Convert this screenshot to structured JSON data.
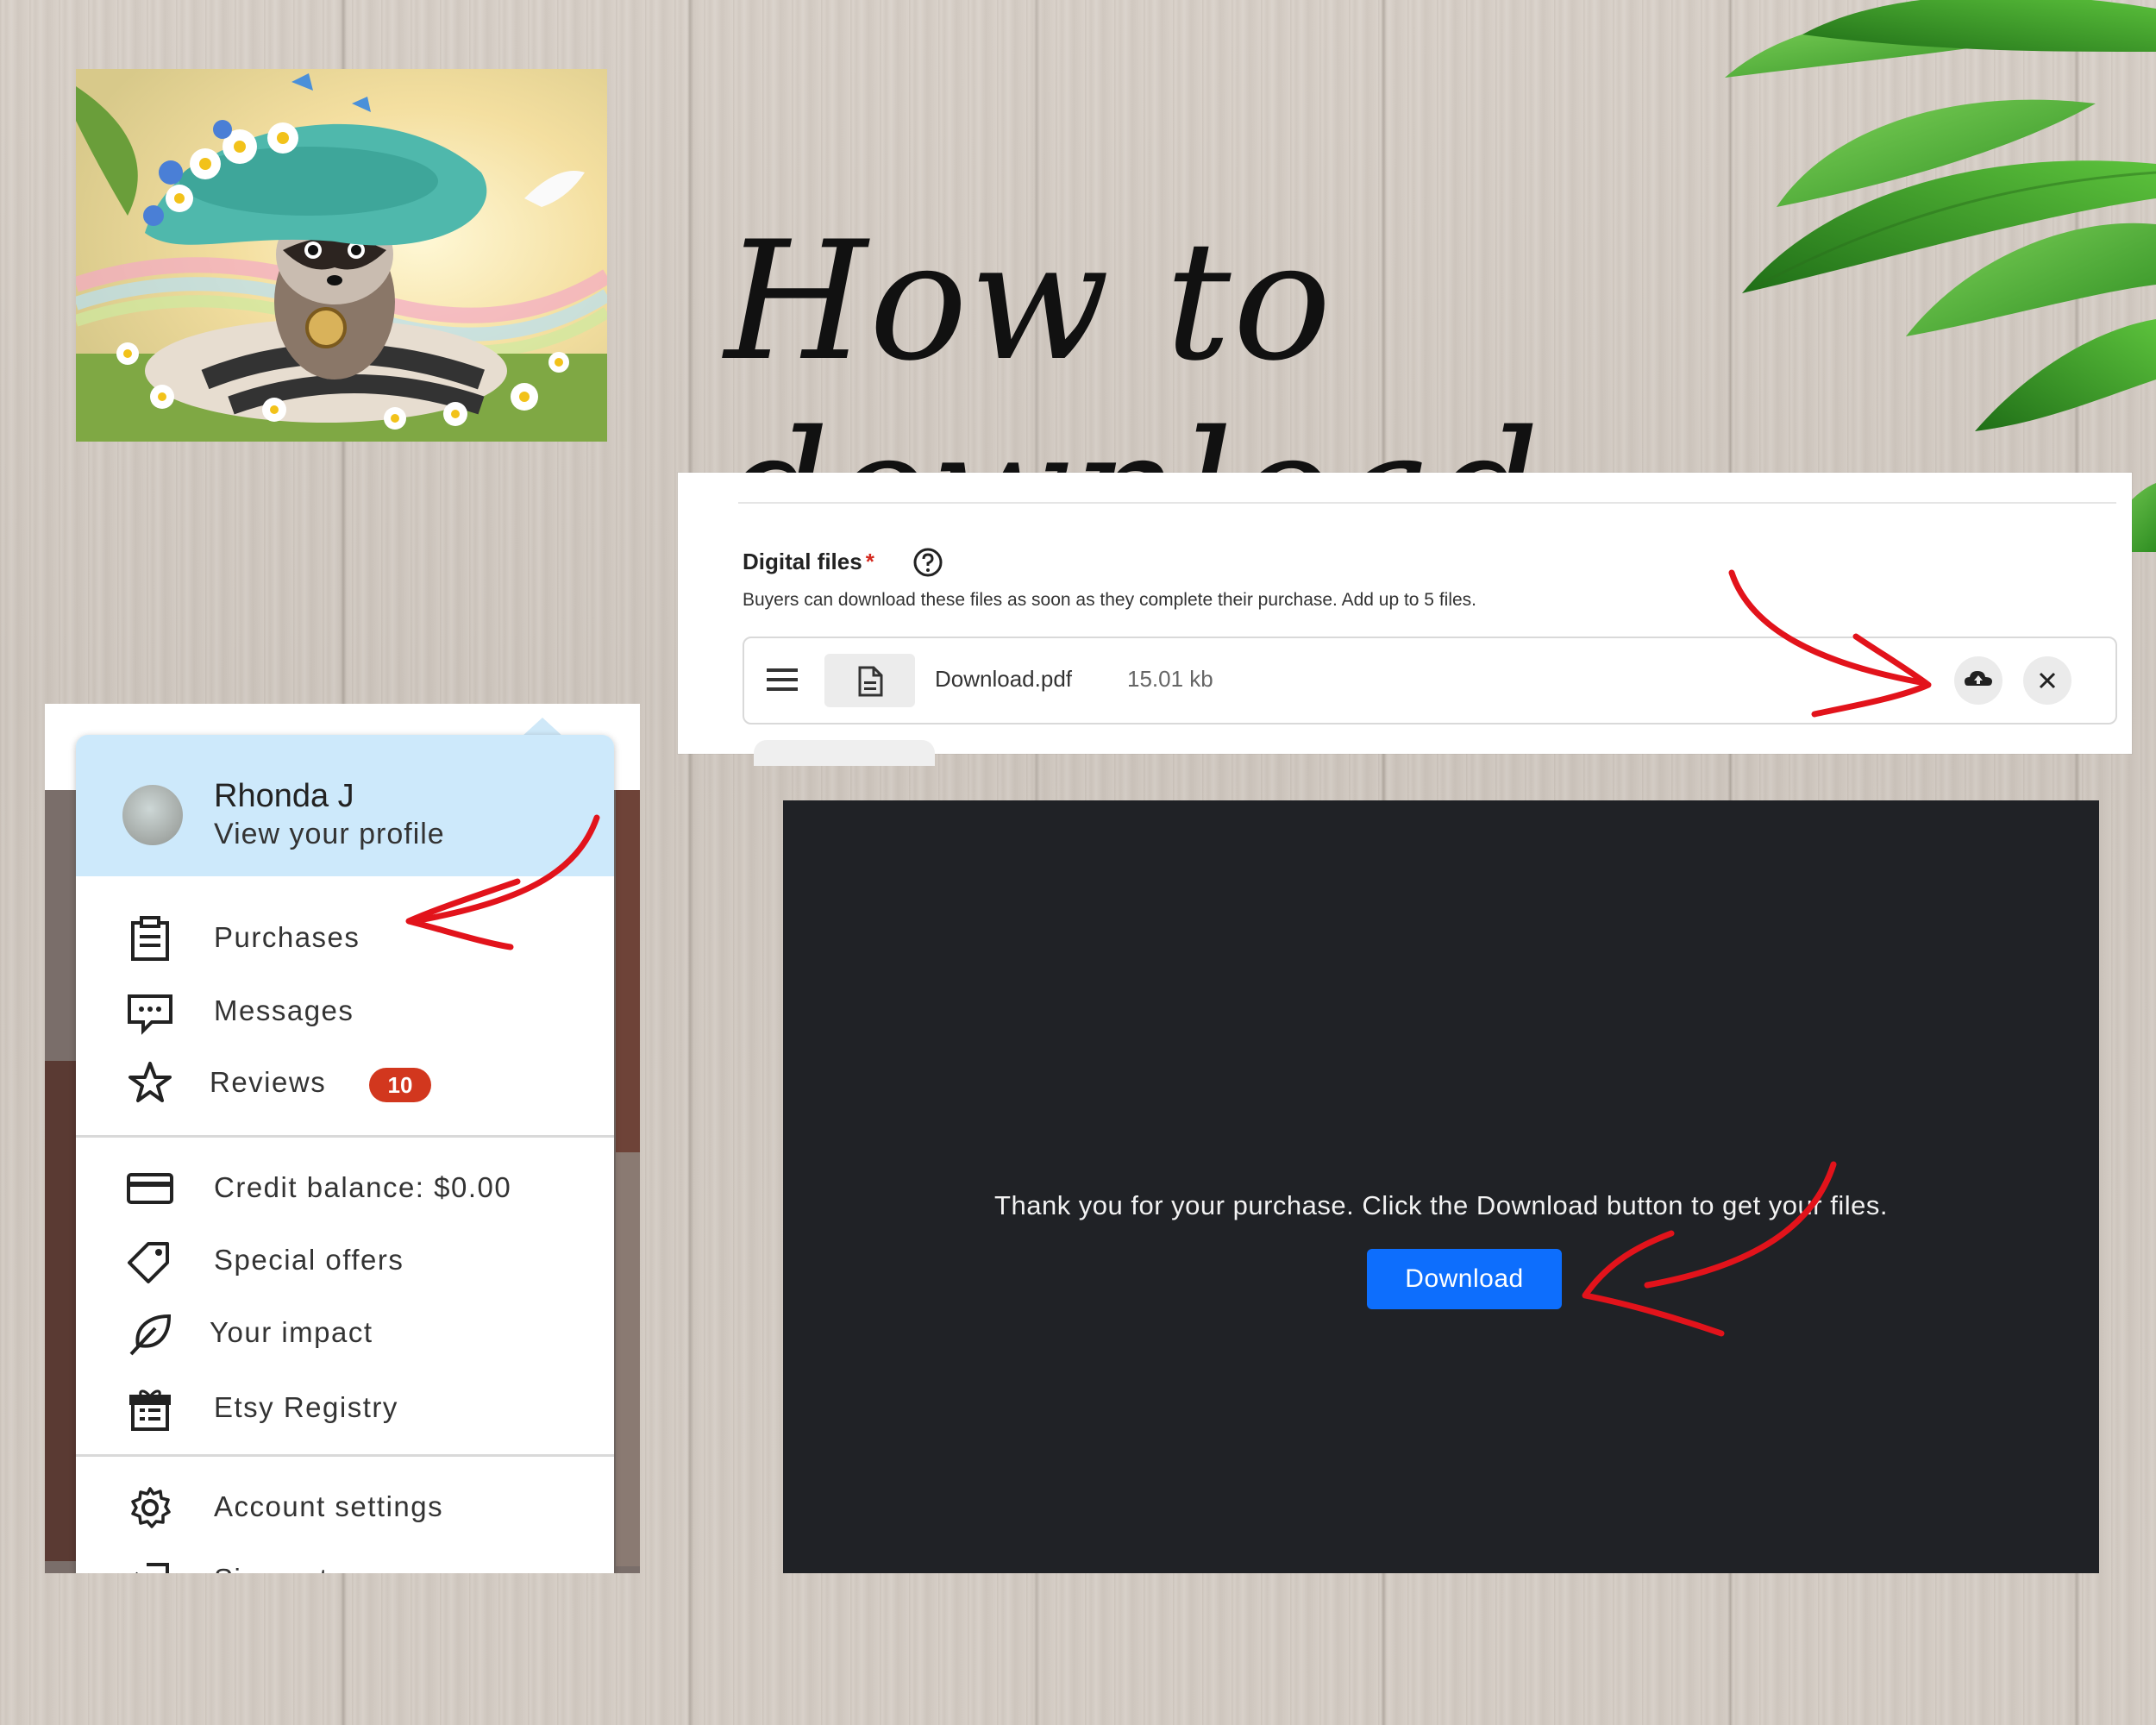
{
  "title": "How to download",
  "colors": {
    "accent_red": "#d4291f",
    "badge_red": "#d2371e",
    "download_blue": "#0d6efd",
    "profile_bg": "#cde9fb",
    "dark_panel": "#202226"
  },
  "hero": {
    "icon": "raccoon-illustration"
  },
  "digital_files": {
    "heading": "Digital files",
    "required_mark": "*",
    "help_icon": "question-circle-icon",
    "description": "Buyers can download these files as soon as they complete their purchase. Add up to 5 files.",
    "file": {
      "name": "Download.pdf",
      "size": "15.01 kb",
      "drag_icon": "hamburger-icon",
      "type_icon": "document-icon",
      "upload_icon": "cloud-upload-icon",
      "remove_icon": "close-icon"
    }
  },
  "account_menu": {
    "profile": {
      "name": "Rhonda J",
      "link": "View your profile"
    },
    "items": [
      {
        "label": "Purchases",
        "icon": "clipboard-icon"
      },
      {
        "label": "Messages",
        "icon": "message-icon"
      },
      {
        "label": "Reviews",
        "icon": "star-icon",
        "badge": "10"
      },
      {
        "label": "Credit balance: $0.00",
        "icon": "credit-card-icon"
      },
      {
        "label": "Special offers",
        "icon": "tag-icon"
      },
      {
        "label": "Your impact",
        "icon": "leaf-icon"
      },
      {
        "label": "Etsy Registry",
        "icon": "gift-icon"
      },
      {
        "label": "Account settings",
        "icon": "gear-icon"
      },
      {
        "label": "Sign out",
        "icon": "sign-out-icon"
      }
    ]
  },
  "download_screen": {
    "message": "Thank you for your purchase. Click the Download button to get your files.",
    "button": "Download"
  }
}
